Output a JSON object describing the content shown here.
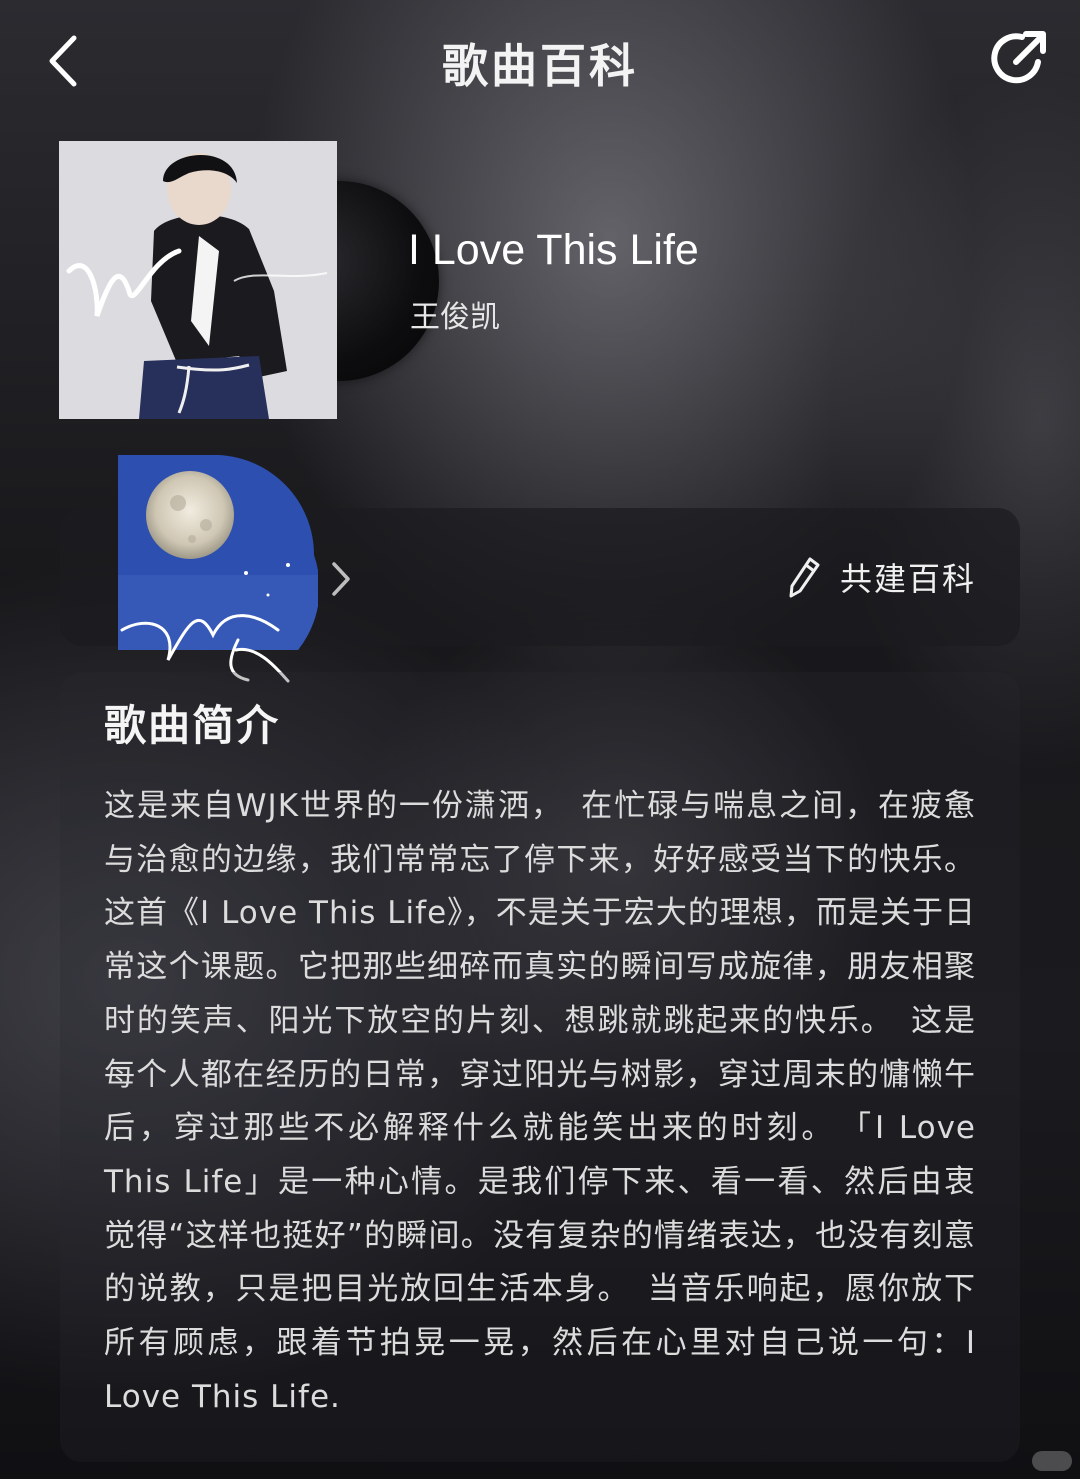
{
  "header": {
    "title": "歌曲百科",
    "back_icon": "chevron-left-icon",
    "share_icon": "share-icon"
  },
  "song": {
    "title": "I Love This Life",
    "artist": "王俊凯"
  },
  "wiki_card": {
    "contribute_label": "共建百科",
    "contribute_icon": "pencil-icon",
    "chevron_icon": "chevron-right-icon"
  },
  "intro": {
    "heading": "歌曲简介",
    "text": "这是来自WJK世界的一份潇洒，　在忙碌与喘息之间，在疲惫与治愈的边缘，我们常常忘了停下来，好好感受当下的快乐。这首《I Love This Life》，不是关于宏大的理想，而是关于日常这个课题。它把那些细碎而真实的瞬间写成旋律，朋友相聚时的笑声、阳光下放空的片刻、想跳就跳起来的快乐。　这是每个人都在经历的日常，穿过阳光与树影，穿过周末的慵懒午后，穿过那些不必解释什么就能笑出来的时刻。　「I Love This Life」是一种心情。是我们停下来、看一看、然后由衷觉得“这样也挺好”的瞬间。没有复杂的情绪表达，也没有刻意的说教，只是把目光放回生活本身。　当音乐响起，愿你放下所有顾虑，跟着节拍晃一晃，然后在心里对自己说一句：I Love This Life."
  },
  "colors": {
    "background": "#141417",
    "text_primary": "#ffffff",
    "text_body": "#dcdcdc",
    "card": "#1c1c20"
  }
}
